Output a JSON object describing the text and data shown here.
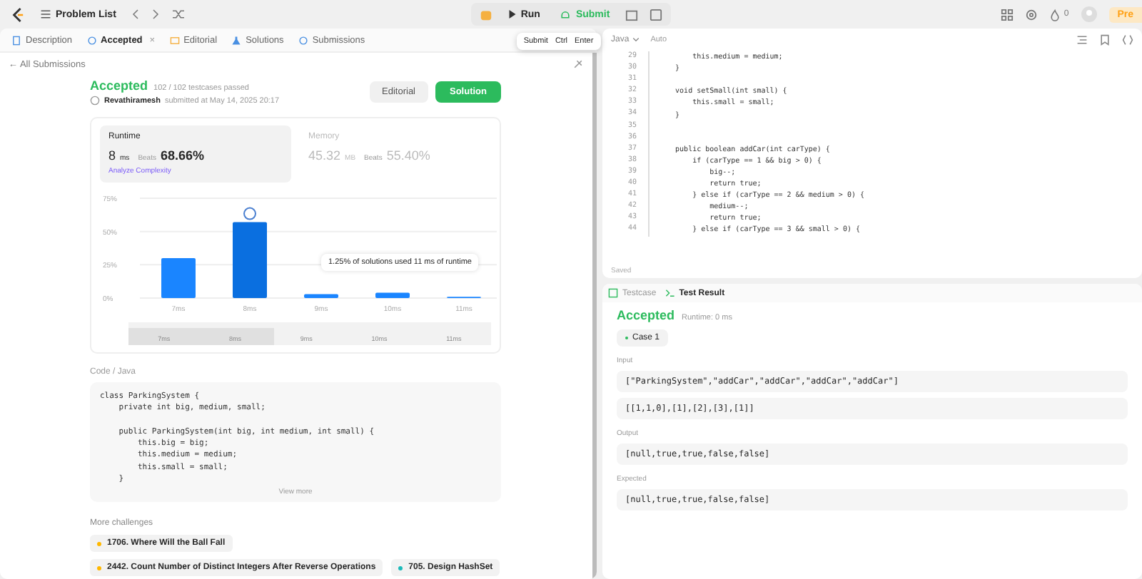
{
  "topbar": {
    "title": "Problem List",
    "run": "Run",
    "submit": "Submit",
    "tooltip": {
      "label": "Submit",
      "keys": [
        "Ctrl",
        "Enter"
      ]
    },
    "streak": "0",
    "premium": "Pre"
  },
  "tabs": [
    {
      "label": "Description",
      "kind": "doc",
      "selected": false
    },
    {
      "label": "Accepted",
      "kind": "history",
      "selected": true,
      "close": "×"
    },
    {
      "label": "Editorial",
      "kind": "book",
      "selected": false
    },
    {
      "label": "Solutions",
      "kind": "flask",
      "selected": false
    },
    {
      "label": "Submissions",
      "kind": "history",
      "selected": false
    }
  ],
  "back_link": {
    "arrow": "←",
    "label": "All Submissions"
  },
  "submission": {
    "status": "Accepted",
    "passed": "102 / 102 testcases passed",
    "user": "Revathiramesh",
    "submitted": "submitted at May 14, 2025 20:17",
    "editorial_button": "Editorial",
    "solution_button": "Solution",
    "runtime": {
      "label": "Runtime",
      "value": "8",
      "unit": "ms",
      "beats_label": "Beats",
      "beats": "68.66%",
      "analyze": "Analyze Complexity",
      "selected": true
    },
    "memory": {
      "label": "Memory",
      "value": "45.32",
      "unit": "MB",
      "beats_label": "Beats",
      "beats": "55.40%",
      "selected": false
    },
    "chart_data": {
      "type": "bar",
      "categories": [
        "7ms",
        "8ms",
        "9ms",
        "10ms",
        "11ms"
      ],
      "values": [
        30,
        57,
        3,
        4,
        1
      ],
      "ylim": [
        0,
        75
      ],
      "yticks": [
        {
          "value": 0,
          "label": "0%"
        },
        {
          "value": 25,
          "label": "25%"
        },
        {
          "value": 50,
          "label": "50%"
        },
        {
          "value": 75,
          "label": "75%"
        }
      ],
      "annotations": [
        "1.25% of solutions used 11 ms of runtime"
      ]
    },
    "range": {
      "labels": [
        "7ms",
        "8ms",
        "9ms",
        "10ms",
        "11ms"
      ],
      "level": 0.4
    },
    "code_label": "Code / Java",
    "code": "class ParkingSystem {\n    private int big, medium, small;\n\n    public ParkingSystem(int big, int medium, int small) {\n        this.big = big;\n        this.medium = medium;\n        this.small = small;\n    }",
    "view_more": "View more"
  },
  "challenges": {
    "title": "More challenges",
    "rows": [
      [
        {
          "label": "1706. Where Will the Ball Fall",
          "color": "#ffb800"
        }
      ],
      [
        {
          "label": "2442. Count Number of Distinct Integers After Reverse Operations",
          "color": "#ffb800"
        },
        {
          "label": "705. Design HashSet",
          "color": "#1cbaba"
        }
      ]
    ]
  },
  "editor": {
    "language": "Java",
    "mode": "Auto",
    "status": "Saved",
    "lines": [
      {
        "n": "29",
        "code": "        this.medium = medium;"
      },
      {
        "n": "30",
        "code": "    }"
      },
      {
        "n": "31"
      },
      {
        "n": "32",
        "code": "    void setSmall(int small) {"
      },
      {
        "n": "33",
        "code": "        this.small = small;"
      },
      {
        "n": "34",
        "code": "    }"
      },
      {
        "n": "35"
      },
      {
        "n": "36"
      },
      {
        "n": "37",
        "code": "    public boolean addCar(int carType) {"
      },
      {
        "n": "38",
        "code": "        if (carType == 1 && big > 0) {"
      },
      {
        "n": "39",
        "code": "            big--;"
      },
      {
        "n": "40",
        "code": "            return true;"
      },
      {
        "n": "41",
        "code": "        } else if (carType == 2 && medium > 0) {"
      },
      {
        "n": "42",
        "code": "            medium--;"
      },
      {
        "n": "43",
        "code": "            return true;"
      },
      {
        "n": "44",
        "code": "        } else if (carType == 3 && small > 0) {"
      }
    ]
  },
  "result": {
    "tabs": [
      {
        "label": "Testcase",
        "kind": "check",
        "selected": false
      },
      {
        "label": "Test Result",
        "kind": "terminal",
        "selected": true
      }
    ],
    "status": "Accepted",
    "runtime": "Runtime: 0 ms",
    "cases": [
      {
        "label": "Case 1",
        "selected": true
      }
    ],
    "sections": [
      {
        "label": "Input",
        "values": [
          "[\"ParkingSystem\",\"addCar\",\"addCar\",\"addCar\",\"addCar\"]",
          "[[1,1,0],[1],[2],[3],[1]]"
        ]
      },
      {
        "label": "Output",
        "values": [
          "[null,true,true,false,false]"
        ]
      },
      {
        "label": "Expected",
        "values": [
          "[null,true,true,false,false]"
        ]
      }
    ]
  }
}
